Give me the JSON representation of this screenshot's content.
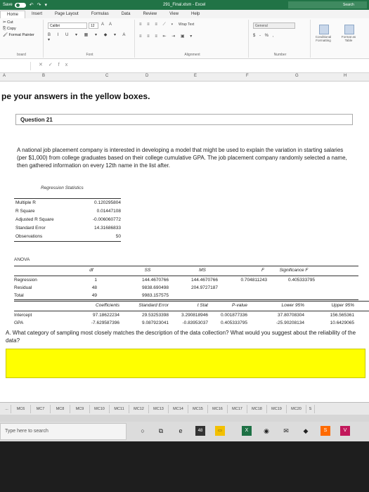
{
  "window": {
    "autosave_label": "Save",
    "title": "291_Final.xlsm - Excel",
    "search_label": "Search"
  },
  "ribbon": {
    "tabs": [
      "Home",
      "Insert",
      "Page Layout",
      "Formulas",
      "Data",
      "Review",
      "View",
      "Help"
    ],
    "clipboard": {
      "cut": "Cut",
      "copy": "Copy",
      "format_painter": "Format Painter",
      "label": "board"
    },
    "font": {
      "name": "Calibri",
      "size": "12",
      "label": "Font"
    },
    "alignment": {
      "wrap_text": "Wrap Text",
      "label": "Alignment"
    },
    "number": {
      "format": "General",
      "currency": "$ - % ,",
      "label": "Number"
    },
    "styles": {
      "conditional": "Conditional Formatting",
      "format_as_table": "Format as Table"
    }
  },
  "formula_bar": {
    "fx": "fx"
  },
  "columns": [
    "A",
    "B",
    "C",
    "D",
    "E",
    "F",
    "G",
    "H"
  ],
  "sheet": {
    "instructions": "pe your answers in the yellow boxes.",
    "question_title": "Question 21",
    "prompt": "A national job placement company is interested in developing a model that might be used to explain the variation in starting salaries (per $1,000) from college graduates based on their college cumulative GPA. The job placement company randomly selected a name, then gathered information on every 12th name in the list after.",
    "regression": {
      "title": "Regression Statistics",
      "rows": [
        {
          "label": "Multiple R",
          "value": "0.120295804"
        },
        {
          "label": "R Square",
          "value": "0.01447108"
        },
        {
          "label": "Adjusted R Square",
          "value": "-0.006060772"
        },
        {
          "label": "Standard Error",
          "value": "14.31686833"
        },
        {
          "label": "Observations",
          "value": "50"
        }
      ]
    },
    "anova": {
      "label": "ANOVA",
      "headers": [
        "",
        "df",
        "SS",
        "MS",
        "F",
        "Significance F"
      ],
      "rows": [
        [
          "Regression",
          "1",
          "144.4670766",
          "144.4670766",
          "0.704811243",
          "0.405333795"
        ],
        [
          "Residual",
          "48",
          "9838.690498",
          "204.9727187",
          "",
          ""
        ],
        [
          "Total",
          "49",
          "9983.157575",
          "",
          "",
          ""
        ]
      ]
    },
    "coefficients": {
      "headers": [
        "",
        "Coefficients",
        "Standard Error",
        "t Stat",
        "P-value",
        "Lower 95%",
        "Upper 95%"
      ],
      "rows": [
        [
          "Intercept",
          "97.18622234",
          "29.53253398",
          "3.290818946",
          "0.001877336",
          "37.80708304",
          "156.565361"
        ],
        [
          "GPA",
          "-7.629587396",
          "9.087923041",
          "-0.83953037",
          "0.405333795",
          "-25.90208134",
          "10.6429065"
        ]
      ]
    },
    "answer_question": "A. What category of sampling most closely matches the description of the data collection? What would you suggest about the reliability of the data?"
  },
  "sheet_tabs": [
    "...",
    "MC6",
    "MC7",
    "MC8",
    "MC9",
    "MC10",
    "MC11",
    "MC12",
    "MC13",
    "MC14",
    "MC15",
    "MC16",
    "MC17",
    "MC18",
    "MC19",
    "MC20",
    "S"
  ],
  "taskbar": {
    "search_placeholder": "Type here to search",
    "badge": "48"
  }
}
